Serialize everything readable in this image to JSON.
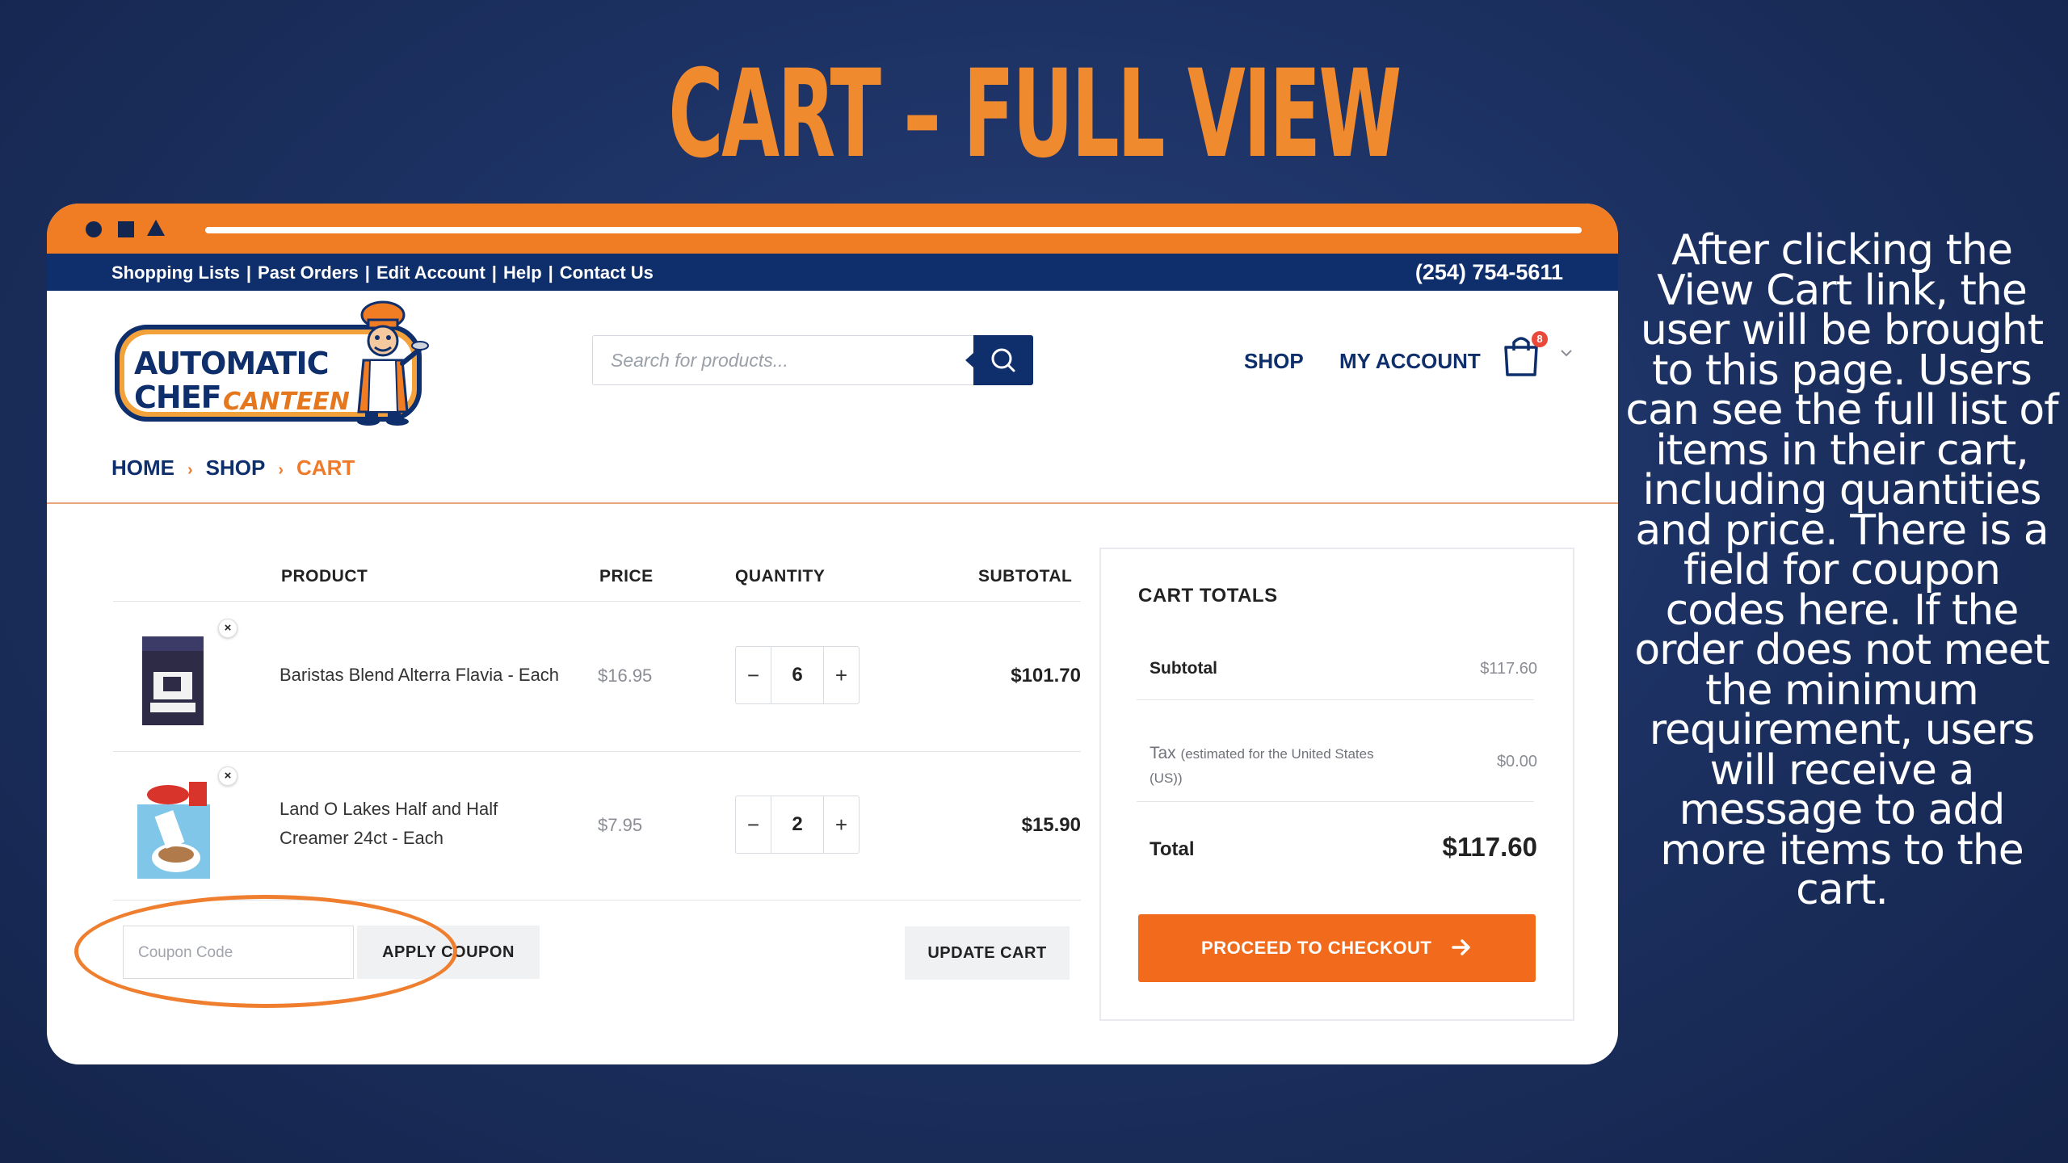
{
  "slide": {
    "title": "CART – FULL VIEW",
    "explanation": "After clicking the View Cart link, the user will be brought to this page. Users can see the full list of items in their cart, including quantities and price. There is a field for coupon codes here. If the order does not meet the minimum requirement, users will receive a message to add more items to the cart."
  },
  "topbar": {
    "links": [
      "Shopping Lists",
      "Past Orders",
      "Edit Account",
      "Help",
      "Contact Us"
    ],
    "phone": "(254) 754-5611"
  },
  "logo": {
    "line1": "AUTOMATIC",
    "line2": "CHEF",
    "line3": "CANTEEN"
  },
  "search": {
    "placeholder": "Search for products..."
  },
  "nav": {
    "shop": "SHOP",
    "account": "MY ACCOUNT",
    "cart_count": "8"
  },
  "breadcrumb": {
    "home": "HOME",
    "shop": "SHOP",
    "current": "CART"
  },
  "table": {
    "headers": {
      "product": "PRODUCT",
      "price": "PRICE",
      "quantity": "QUANTITY",
      "subtotal": "SUBTOTAL"
    },
    "rows": [
      {
        "name_line1": "Baristas Blend Alterra Flavia - Each",
        "name_line2": "",
        "price": "$16.95",
        "qty": "6",
        "subtotal": "$101.70",
        "remove": "×"
      },
      {
        "name_line1": "Land O Lakes Half and Half",
        "name_line2": "Creamer 24ct - Each",
        "price": "$7.95",
        "qty": "2",
        "subtotal": "$15.90",
        "remove": "×"
      }
    ],
    "minus": "−",
    "plus": "+"
  },
  "coupon": {
    "placeholder": "Coupon Code",
    "apply": "APPLY COUPON",
    "update": "UPDATE CART"
  },
  "totals": {
    "title": "CART TOTALS",
    "subtotal_label": "Subtotal",
    "subtotal_value": "$117.60",
    "tax_label": "Tax",
    "tax_note_1": "(estimated for the United States",
    "tax_note_2": "(US))",
    "tax_value": "$0.00",
    "total_label": "Total",
    "total_value": "$117.60",
    "checkout": "PROCEED TO CHECKOUT"
  },
  "colors": {
    "navy": "#0e2f6c",
    "orange": "#f07c23",
    "checkout": "#f26a1b"
  }
}
